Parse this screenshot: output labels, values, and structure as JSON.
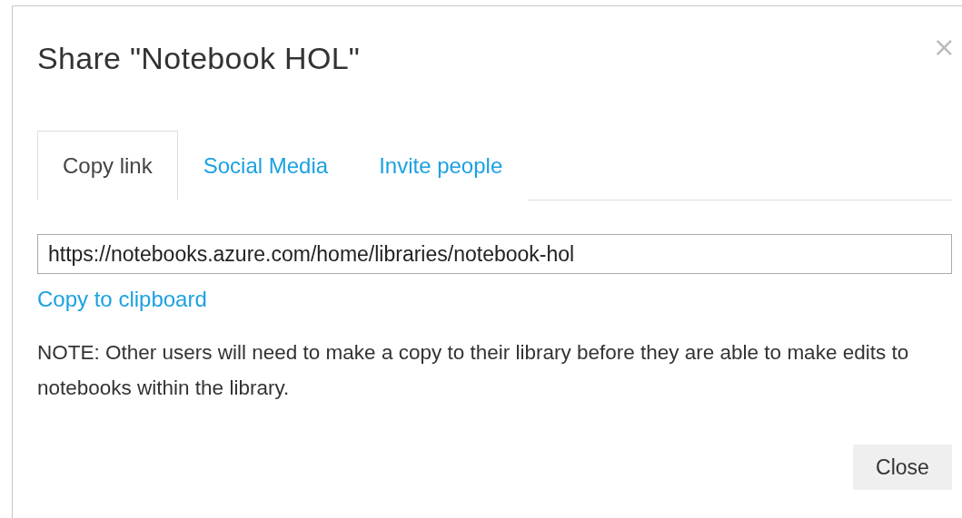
{
  "dialog": {
    "title": "Share \"Notebook HOL\"",
    "close_icon": "×"
  },
  "tabs": [
    {
      "label": "Copy link",
      "selected": true
    },
    {
      "label": "Social Media",
      "selected": false
    },
    {
      "label": "Invite people",
      "selected": false
    }
  ],
  "link_field": {
    "value": "https://notebooks.azure.com/home/libraries/notebook-hol"
  },
  "copy_link": "Copy to clipboard",
  "note": "NOTE: Other users will need to make a copy to their library before they are able to make edits to notebooks within the library.",
  "buttons": [
    "Close"
  ]
}
